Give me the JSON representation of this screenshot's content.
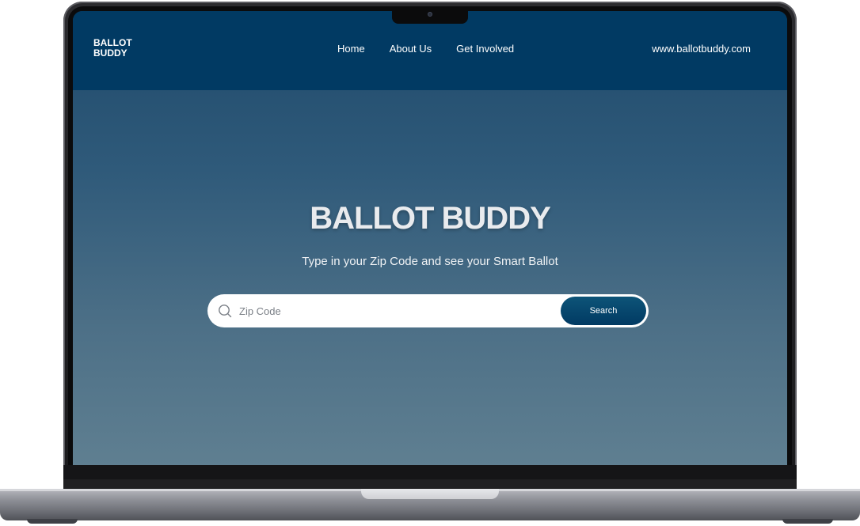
{
  "logo": {
    "line1": "BALLOT",
    "line2": "BUDDY"
  },
  "nav": {
    "items": [
      {
        "label": "Home"
      },
      {
        "label": "About Us"
      },
      {
        "label": "Get Involved"
      }
    ],
    "site_url": "www.ballotbuddy.com"
  },
  "hero": {
    "title": "BALLOT BUDDY",
    "subtitle": "Type in your Zip Code and see your Smart Ballot"
  },
  "search": {
    "placeholder": "Zip Code",
    "value": "",
    "button_label": "Search",
    "icon": "search-icon"
  },
  "colors": {
    "header": "#013a63",
    "button": "#013a63",
    "hero_top": "#1f4a6b",
    "hero_bottom": "#5f7f91"
  }
}
